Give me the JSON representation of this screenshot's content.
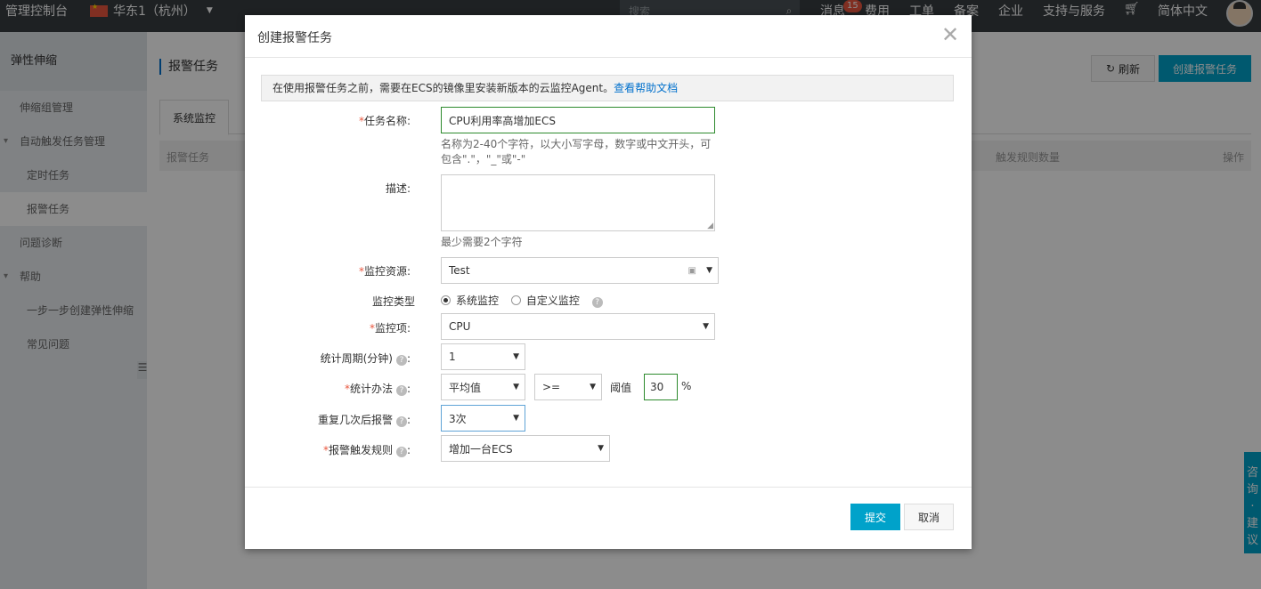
{
  "topbar": {
    "brand": "管理控制台",
    "region": "华东1（杭州）",
    "search_placeholder": "搜索",
    "nav": [
      "消息",
      "费用",
      "工单",
      "备案",
      "企业",
      "支持与服务",
      "简体中文"
    ],
    "message_count": "15"
  },
  "sidebar": {
    "title": "弹性伸缩",
    "items": [
      "伸缩组管理",
      "自动触发任务管理",
      "定时任务",
      "报警任务",
      "问题诊断",
      "帮助",
      "一步一步创建弹性伸缩",
      "常见问题"
    ]
  },
  "page": {
    "title": "报警任务",
    "refresh": "刷新",
    "create": "创建报警任务",
    "tab": "系统监控",
    "columns": {
      "task": "报警任务",
      "rule_count": "触发规则数量",
      "ops": "操作"
    }
  },
  "consult": [
    "咨",
    "询",
    "·",
    "建",
    "议"
  ],
  "modal": {
    "title": "创建报警任务",
    "notice_text": "在使用报警任务之前，需要在ECS的镜像里安装新版本的云监控Agent。",
    "notice_link": "查看帮助文档",
    "name_label": "任务名称:",
    "name_value": "CPU利用率高增加ECS",
    "name_hint_1": "名称为2-40个字符，以大小写字母，数字或中文开头，可",
    "name_hint_2": "包含\".\"，\"_\"或\"-\"",
    "desc_label": "描述:",
    "desc_hint": "最少需要2个字符",
    "resource_label": "监控资源:",
    "resource_value": "Test",
    "type_label": "监控类型",
    "type_system": "系统监控",
    "type_custom": "自定义监控",
    "item_label": "监控项:",
    "item_value": "CPU",
    "period_label": "统计周期(分钟)",
    "period_value": "1",
    "method_label": "统计办法",
    "method_value": "平均值",
    "compare_value": ">=",
    "threshold_label": "阈值",
    "threshold_value": "30",
    "threshold_unit": "%",
    "repeat_label": "重复几次后报警",
    "repeat_value": "3次",
    "rule_label": "报警触发规则",
    "rule_value": "增加一台ECS",
    "submit": "提交",
    "cancel": "取消"
  }
}
